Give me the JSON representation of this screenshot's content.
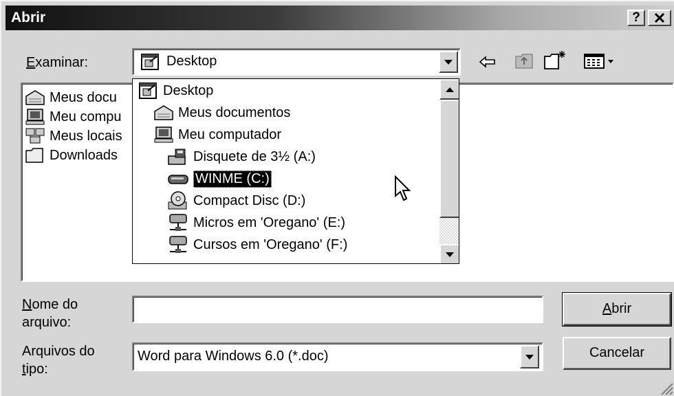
{
  "window": {
    "title": "Abrir",
    "help_label": "?",
    "close_label": "✕"
  },
  "lookin": {
    "label_underline": "E",
    "label_rest": "xaminar:",
    "value": "Desktop"
  },
  "left_list": {
    "items": [
      {
        "label": "Meus docu",
        "icon": "my-documents-icon"
      },
      {
        "label": "Meu compu",
        "icon": "my-computer-icon"
      },
      {
        "label": "Meus locais",
        "icon": "network-places-icon"
      },
      {
        "label": "Downloads",
        "icon": "folder-icon"
      }
    ]
  },
  "dropdown": {
    "items": [
      {
        "label": "Desktop",
        "icon": "desktop-icon"
      },
      {
        "label": "Meus documentos",
        "icon": "my-documents-icon"
      },
      {
        "label": "Meu computador",
        "icon": "my-computer-icon"
      },
      {
        "label": "Disquete de 3½ (A:)",
        "icon": "floppy-drive-icon"
      },
      {
        "label": "WINME (C:)",
        "icon": "hard-drive-icon",
        "selected": true
      },
      {
        "label": "Compact Disc (D:)",
        "icon": "cd-drive-icon"
      },
      {
        "label": "Micros em 'Oregano' (E:)",
        "icon": "network-drive-icon"
      },
      {
        "label": "Cursos em 'Oregano' (F:)",
        "icon": "network-drive-icon"
      }
    ]
  },
  "filename": {
    "label_u": "N",
    "label_rest1": "ome do",
    "label_rest2": "arquivo:",
    "value": ""
  },
  "filetype": {
    "label1": "Arquivos do",
    "label2_u": "t",
    "label2_rest": "ipo:",
    "value": "Word para Windows 6.0 (*.doc)"
  },
  "buttons": {
    "open_u": "A",
    "open_rest": "brir",
    "cancel": "Cancelar"
  },
  "toolbar": {
    "back_icon": "back-arrow-icon",
    "up_icon": "up-folder-icon",
    "new_folder_icon": "new-folder-icon",
    "view_menu_icon": "view-menu-icon"
  }
}
